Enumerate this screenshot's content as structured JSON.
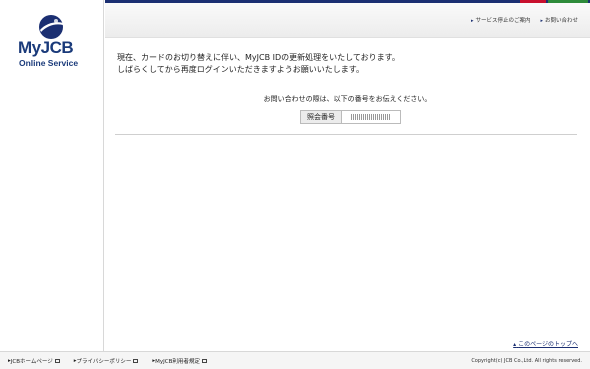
{
  "brand": {
    "name": "MyJCB",
    "tagline": "Online Service",
    "colors": {
      "primary": "#1b2f72",
      "accent_red": "#c8102e",
      "accent_green": "#2e8b3a"
    }
  },
  "header": {
    "links": [
      {
        "label": "サービス停止のご案内",
        "icon": "arrow-right-icon"
      },
      {
        "label": "お問い合わせ",
        "icon": "arrow-right-icon"
      }
    ]
  },
  "main": {
    "message_line1": "現在、カードのお切り替えに伴い、MyJCB IDの更新処理をいたしております。",
    "message_line2": "しばらくしてから再度ログインいただきますようお願いいたします。",
    "inquiry_text": "お問い合わせの際は、以下の番号をお伝えください。",
    "reference": {
      "label": "照会番号",
      "value": ""
    }
  },
  "page_top_link": "このページのトップへ",
  "footer": {
    "links": [
      {
        "label": "JCBホームページ"
      },
      {
        "label": "プライバシーポリシー"
      },
      {
        "label": "MyJCB利用者規定"
      }
    ],
    "copyright": "Copyright(c) JCB Co.,Ltd. All rights reserved."
  }
}
